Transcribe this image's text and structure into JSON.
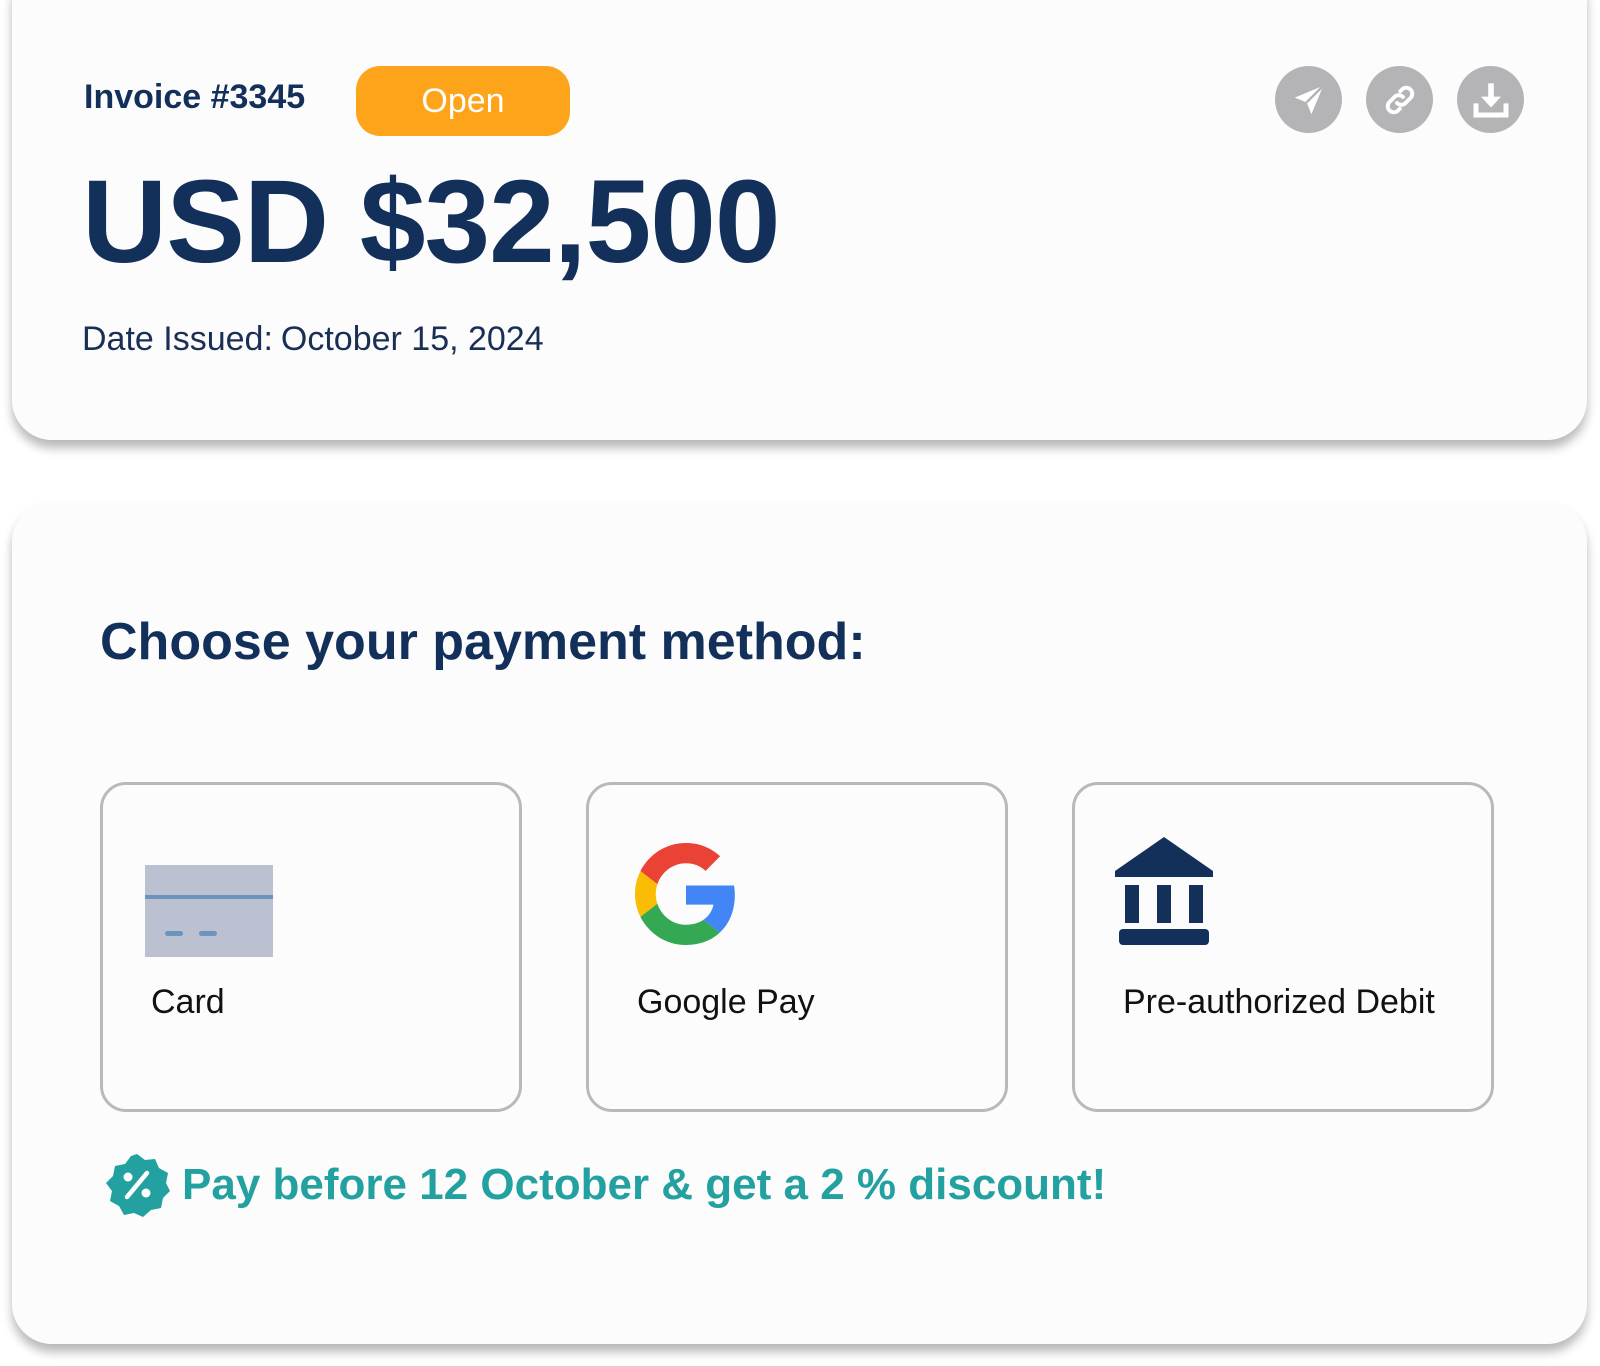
{
  "invoice": {
    "number": "Invoice #3345",
    "status": "Open",
    "amount": "USD $32,500",
    "date_label": "Date Issued:",
    "date_value": "October 15, 2024"
  },
  "actions": [
    {
      "icon": "send-icon"
    },
    {
      "icon": "link-icon"
    },
    {
      "icon": "download-icon"
    }
  ],
  "payment": {
    "title": "Choose your payment method:",
    "methods": [
      {
        "label": "Card",
        "icon": "credit-card-icon"
      },
      {
        "label": "Google Pay",
        "icon": "google-g-icon"
      },
      {
        "label": "Pre-authorized Debit",
        "icon": "bank-icon"
      }
    ],
    "promo": "Pay before 12 October & get a 2 % discount!"
  },
  "colors": {
    "navy": "#13305b",
    "status_orange": "#fea41a",
    "action_gray": "#b4b4b6",
    "promo_teal": "#23a0a0",
    "tile_border": "#bcb7bb"
  }
}
